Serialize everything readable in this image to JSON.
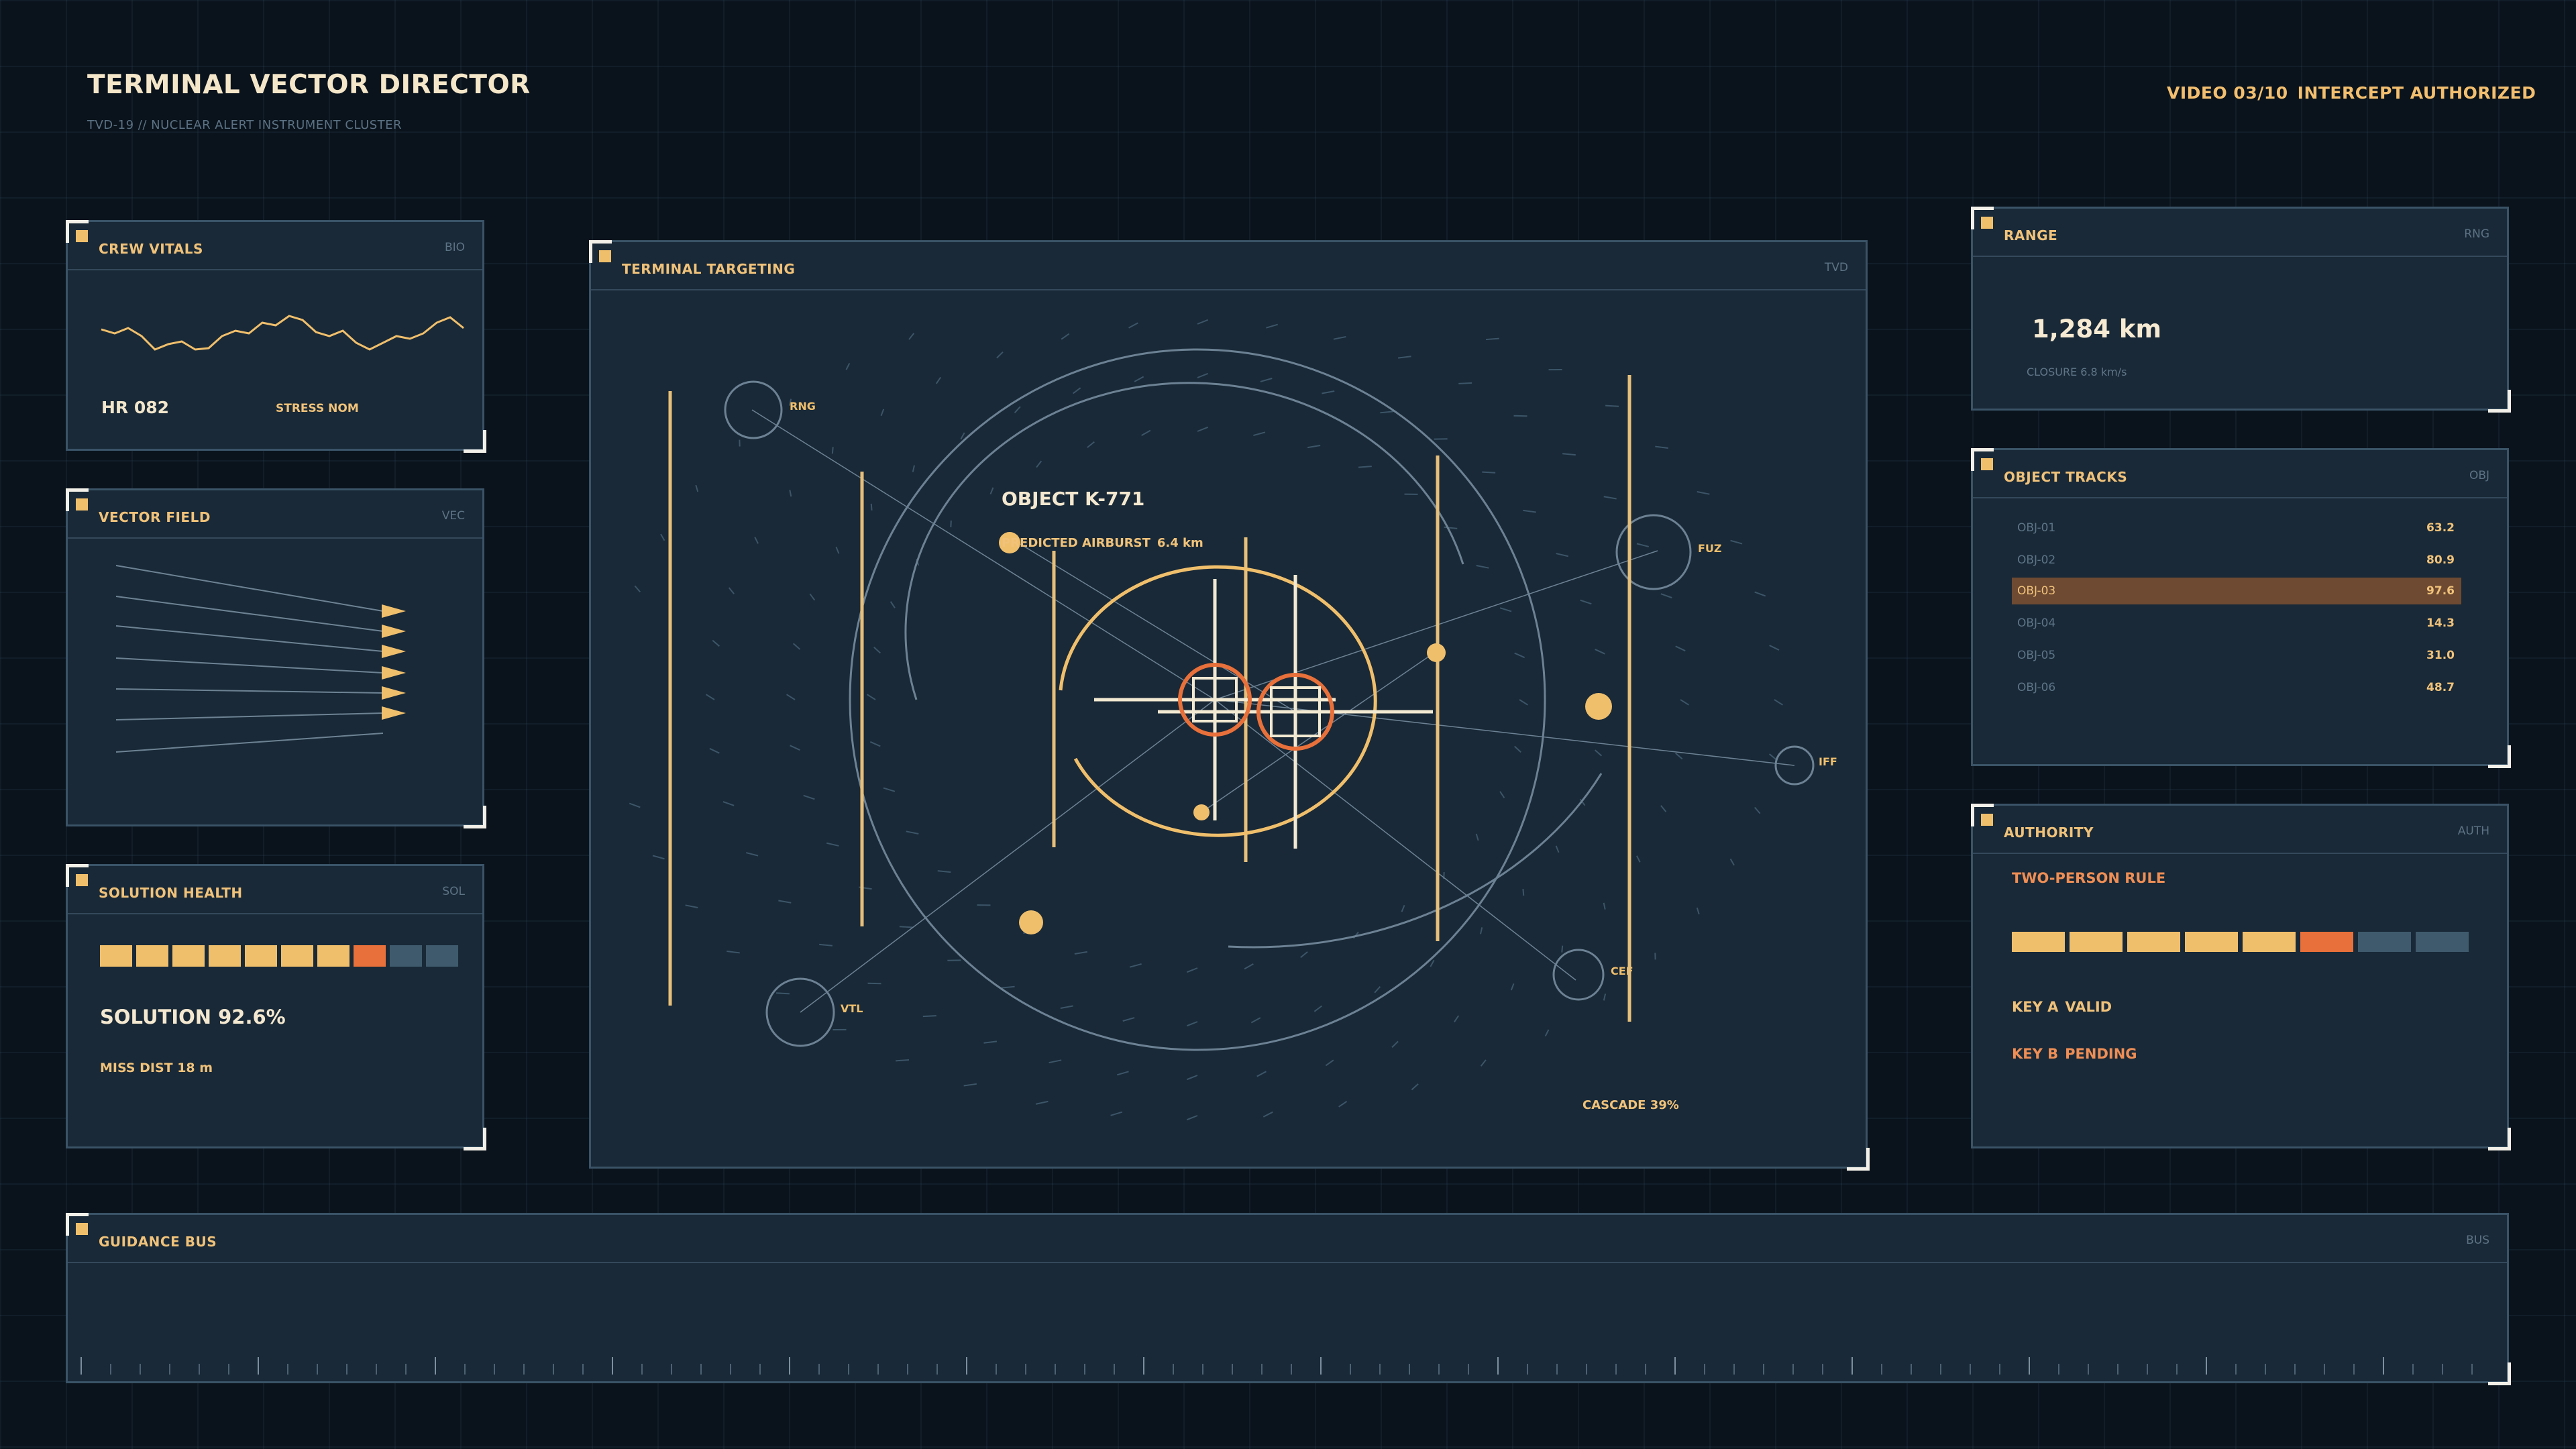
{
  "header": {
    "title": "TERMINAL VECTOR DIRECTOR",
    "subtitle": "TVD-19 // NUCLEAR ALERT INSTRUMENT CLUSTER",
    "video": "VIDEO 03/10",
    "intercept": "INTERCEPT AUTHORIZED"
  },
  "crew_vitals": {
    "title": "CREW VITALS",
    "tag": "BIO",
    "hr": "HR 082",
    "stress": "STRESS NOM"
  },
  "vector_field": {
    "title": "VECTOR FIELD",
    "tag": "VEC"
  },
  "solution_health": {
    "title": "SOLUTION HEALTH",
    "tag": "SOL",
    "solution": "SOLUTION 92.6%",
    "miss": "MISS DIST 18 m",
    "segments": [
      "on",
      "on",
      "on",
      "on",
      "on",
      "on",
      "on",
      "alert",
      "off",
      "off"
    ]
  },
  "targeting": {
    "title": "TERMINAL TARGETING",
    "tag": "TVD",
    "object": "OBJECT K-771",
    "predicted": "PREDICTED AIRBURST",
    "predicted_dist": "6.4 km",
    "labels": {
      "rng": "RNG",
      "fuz": "FUZ",
      "iff": "IFF",
      "vtl": "VTL",
      "cef": "CEF"
    },
    "cascade": "CASCADE 39%"
  },
  "range": {
    "title": "RANGE",
    "tag": "RNG",
    "value": "1,284 km",
    "closure": "CLOSURE 6.8 km/s"
  },
  "object_tracks": {
    "title": "OBJECT TRACKS",
    "tag": "OBJ",
    "rows": [
      {
        "id": "OBJ-01",
        "val": "63.2"
      },
      {
        "id": "OBJ-02",
        "val": "80.9"
      },
      {
        "id": "OBJ-03",
        "val": "97.6"
      },
      {
        "id": "OBJ-04",
        "val": "14.3"
      },
      {
        "id": "OBJ-05",
        "val": "31.0"
      },
      {
        "id": "OBJ-06",
        "val": "48.7"
      }
    ],
    "selected": 2
  },
  "authority": {
    "title": "AUTHORITY",
    "tag": "AUTH",
    "rule": "TWO-PERSON RULE",
    "key_a_label": "KEY A",
    "key_a_status": "VALID",
    "key_b_label": "KEY B",
    "key_b_status": "PENDING",
    "segments": [
      "on",
      "on",
      "on",
      "on",
      "on",
      "alert",
      "off",
      "off"
    ]
  },
  "guidance_bus": {
    "title": "GUIDANCE BUS",
    "tag": "BUS"
  },
  "colors": {
    "amber": "#f0bf6c",
    "orange": "#e8703a",
    "slate": "#3f5a6d",
    "panel": "#192937"
  }
}
